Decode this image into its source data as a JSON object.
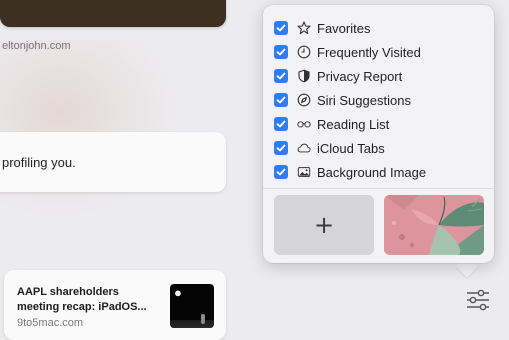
{
  "background": {
    "site_label": "eltonjohn.com",
    "card_text": "profiling you.",
    "news": {
      "title": "AAPL shareholders meeting recap: iPadOS...",
      "source": "9to5mac.com"
    }
  },
  "popover": {
    "options": [
      {
        "label": "Favorites",
        "icon": "star-icon",
        "checked": true
      },
      {
        "label": "Frequently Visited",
        "icon": "clock-icon",
        "checked": true
      },
      {
        "label": "Privacy Report",
        "icon": "shield-icon",
        "checked": true
      },
      {
        "label": "Siri Suggestions",
        "icon": "compass-icon",
        "checked": true
      },
      {
        "label": "Reading List",
        "icon": "glasses-icon",
        "checked": true
      },
      {
        "label": "iCloud Tabs",
        "icon": "cloud-icon",
        "checked": true
      },
      {
        "label": "Background Image",
        "icon": "photo-icon",
        "checked": true
      }
    ],
    "add_label": "+"
  },
  "colors": {
    "accent": "#2f7cf6",
    "popover_bg": "#f3f3f5",
    "page_bg": "#ececee"
  }
}
